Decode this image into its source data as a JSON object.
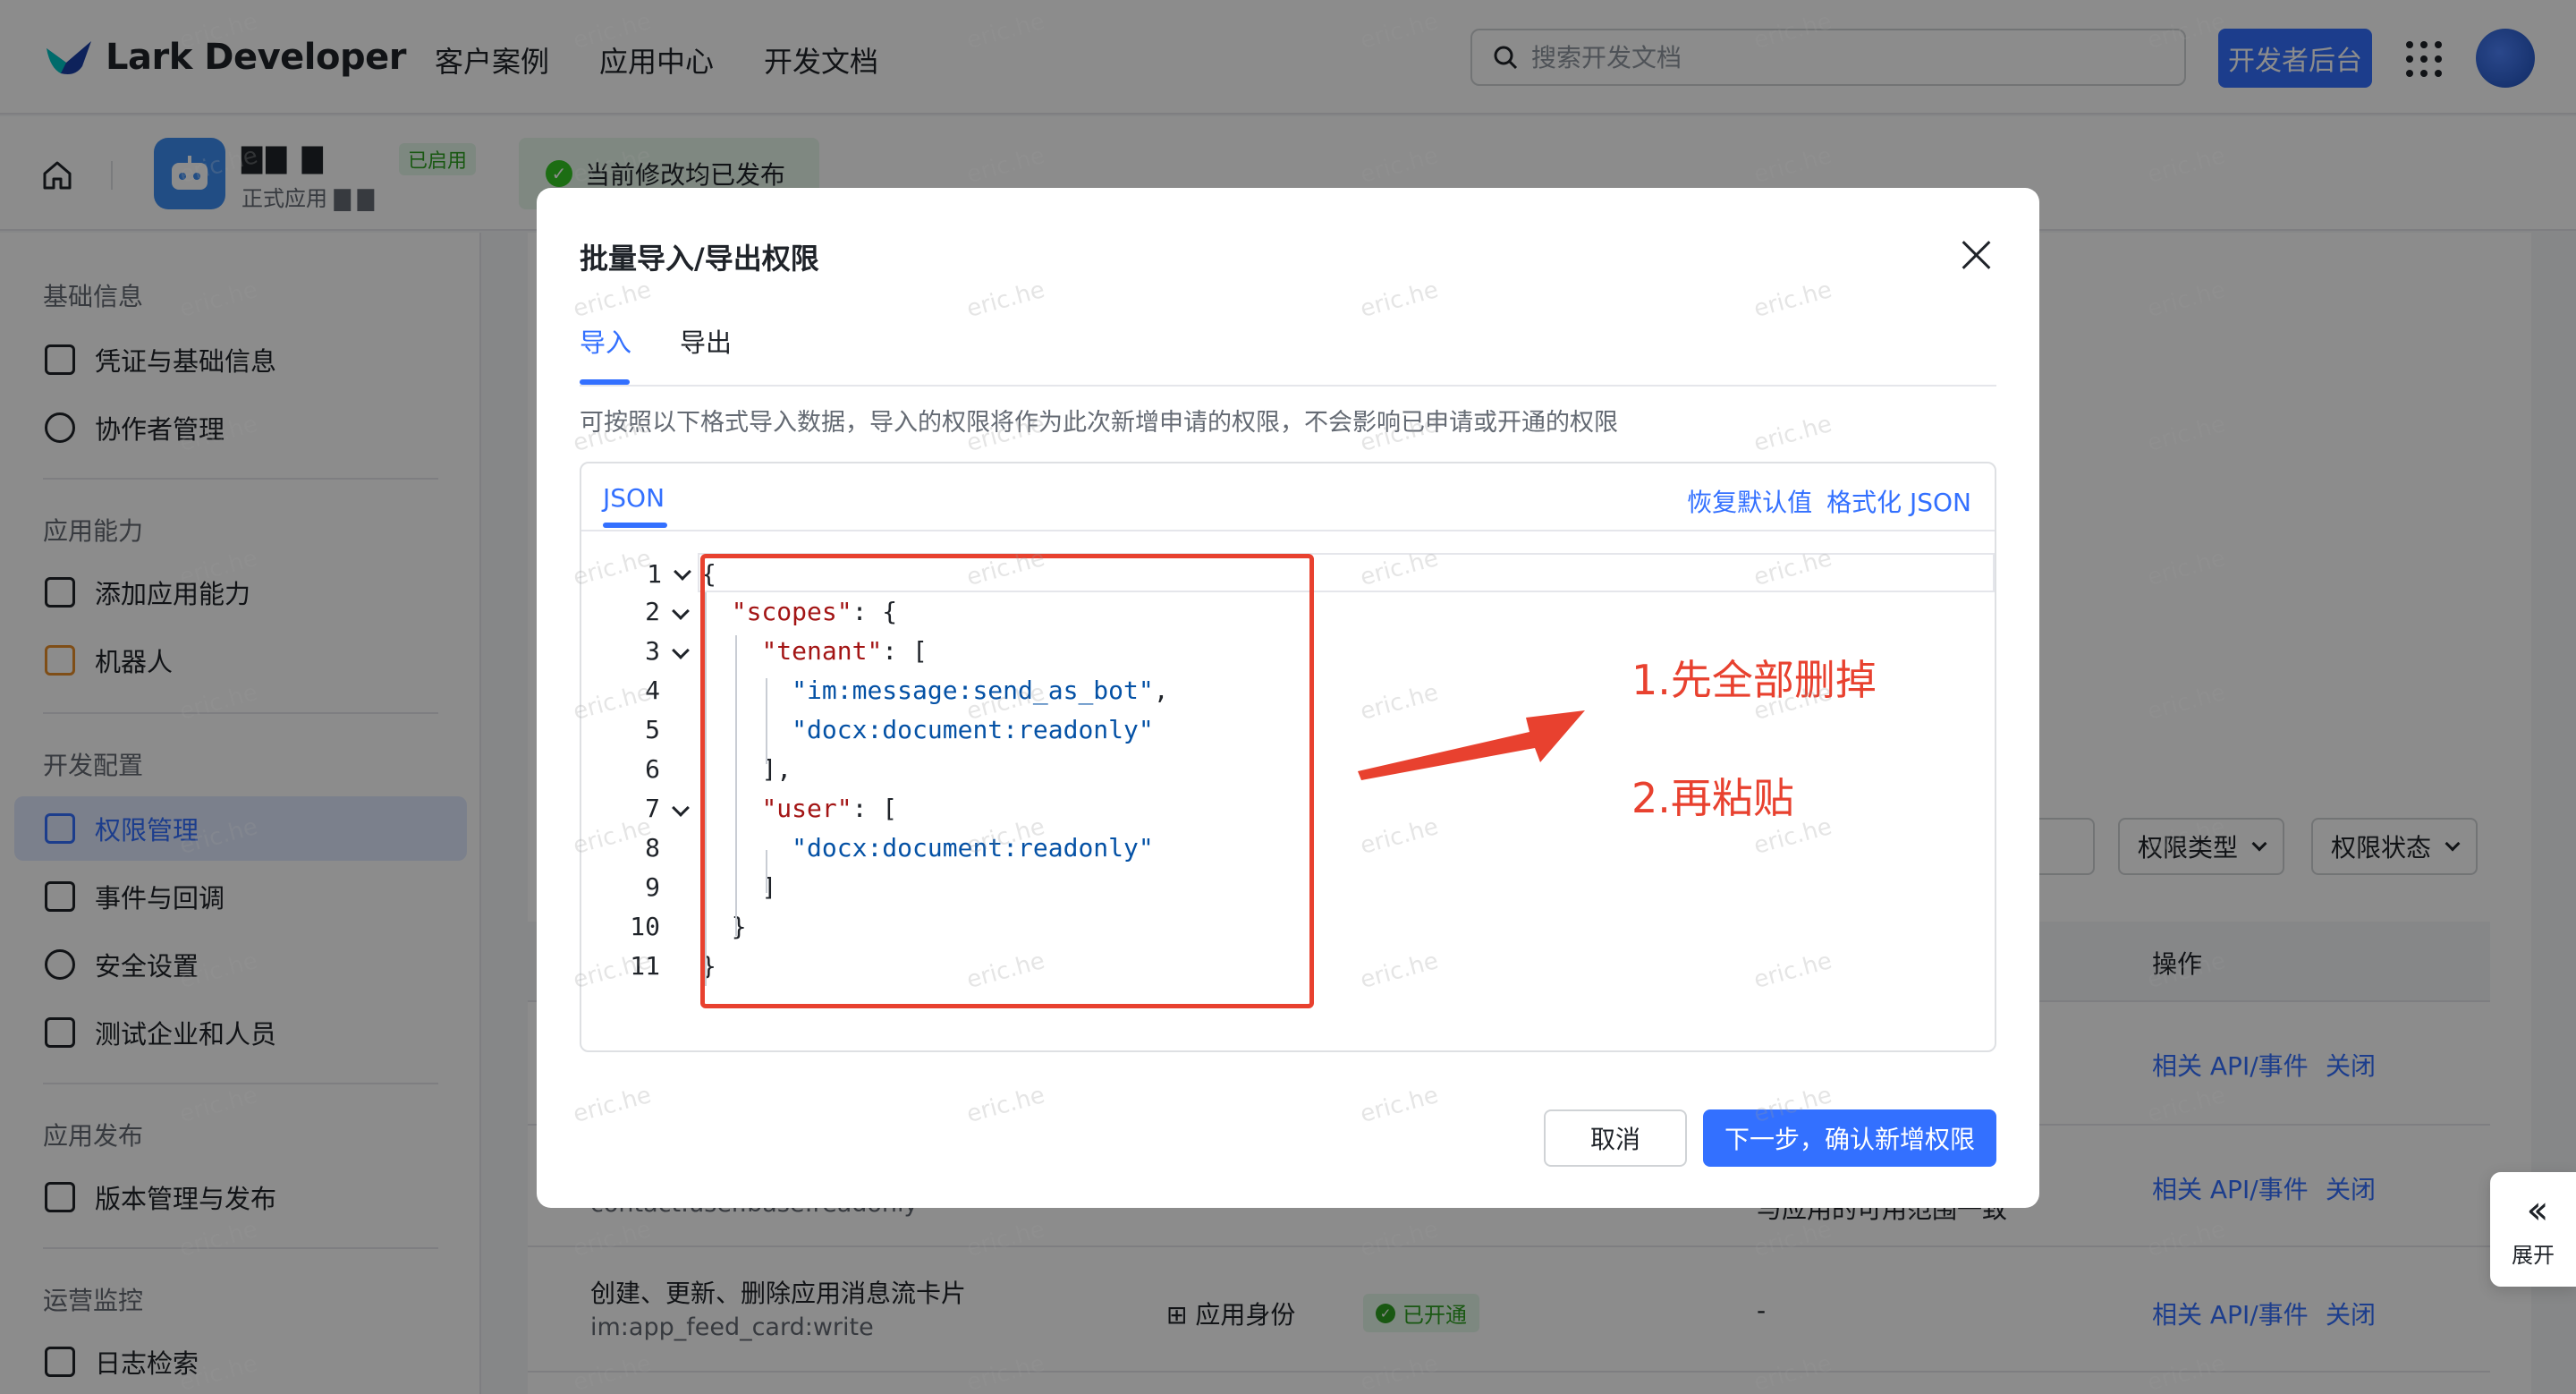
{
  "topnav": {
    "brand": "Lark Developer",
    "links": [
      "客户案例",
      "应用中心",
      "开发文档"
    ],
    "search_placeholder": "搜索开发文档",
    "console_button": "开发者后台"
  },
  "app_header": {
    "app_sub": "正式应用",
    "status_badge": "已启用",
    "publish_status": "当前修改均已发布"
  },
  "sidebar": {
    "sections": [
      {
        "title": "基础信息",
        "items": [
          "凭证与基础信息",
          "协作者管理"
        ]
      },
      {
        "title": "应用能力",
        "items": [
          "添加应用能力",
          "机器人"
        ]
      },
      {
        "title": "开发配置",
        "items": [
          "权限管理",
          "事件与回调",
          "安全设置",
          "测试企业和人员"
        ]
      },
      {
        "title": "应用发布",
        "items": [
          "版本管理与发布"
        ]
      },
      {
        "title": "运营监控",
        "items": [
          "日志检索"
        ]
      }
    ],
    "active_item": "权限管理"
  },
  "permissions_table": {
    "filters": [
      "权限类型",
      "权限状态"
    ],
    "op_header": "操作",
    "row_links": [
      "相关 API/事件",
      "关闭"
    ],
    "row2_scope_partial": "contact:user.base:readonly",
    "row2_range_partial": "与应用的可用范围一致",
    "row3": {
      "name": "创建、更新、删除应用消息流卡片",
      "scope": "im:app_feed_card:write",
      "identity": "应用身份",
      "status": "已开通",
      "range": "-"
    }
  },
  "modal": {
    "title": "批量导入/导出权限",
    "tabs": [
      "导入",
      "导出"
    ],
    "description": "可按照以下格式导入数据，导入的权限将作为此次新增申请的权限，不会影响已申请或开通的权限",
    "editor_tab": "JSON",
    "restore_default": "恢复默认值",
    "format_json": "格式化 JSON",
    "code_lines": [
      {
        "n": "1",
        "indent": 0,
        "fold": true,
        "parts": [
          [
            "p",
            "{"
          ]
        ]
      },
      {
        "n": "2",
        "indent": 1,
        "fold": true,
        "parts": [
          [
            "k",
            "\"scopes\""
          ],
          [
            "p",
            ": {"
          ]
        ]
      },
      {
        "n": "3",
        "indent": 2,
        "fold": true,
        "parts": [
          [
            "k",
            "\"tenant\""
          ],
          [
            "p",
            ": ["
          ]
        ]
      },
      {
        "n": "4",
        "indent": 3,
        "fold": false,
        "parts": [
          [
            "s",
            "\"im:message:send_as_bot\""
          ],
          [
            "p",
            ","
          ]
        ]
      },
      {
        "n": "5",
        "indent": 3,
        "fold": false,
        "parts": [
          [
            "s",
            "\"docx:document:readonly\""
          ]
        ]
      },
      {
        "n": "6",
        "indent": 2,
        "fold": false,
        "parts": [
          [
            "p",
            "],"
          ]
        ]
      },
      {
        "n": "7",
        "indent": 2,
        "fold": true,
        "parts": [
          [
            "k",
            "\"user\""
          ],
          [
            "p",
            ": ["
          ]
        ]
      },
      {
        "n": "8",
        "indent": 3,
        "fold": false,
        "parts": [
          [
            "s",
            "\"docx:document:readonly\""
          ]
        ]
      },
      {
        "n": "9",
        "indent": 2,
        "fold": false,
        "parts": [
          [
            "p",
            "]"
          ]
        ]
      },
      {
        "n": "10",
        "indent": 1,
        "fold": false,
        "parts": [
          [
            "p",
            "}"
          ]
        ]
      },
      {
        "n": "11",
        "indent": 0,
        "fold": false,
        "parts": [
          [
            "p",
            "}"
          ]
        ]
      }
    ],
    "cancel": "取消",
    "next": "下一步，确认新增权限"
  },
  "annotations": {
    "step1": "1.先全部删掉",
    "step2": "2.再粘贴",
    "color": "#e8412f"
  },
  "expand_button": "展开",
  "watermark": "eric.he",
  "colors": {
    "primary": "#3370ff",
    "success": "#2ea121"
  }
}
